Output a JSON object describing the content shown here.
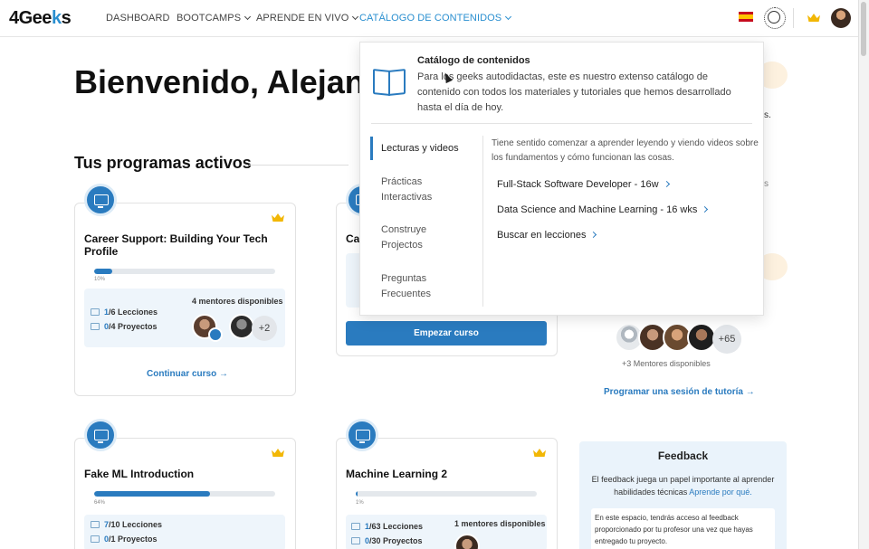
{
  "nav": {
    "logo": "4Geeks",
    "links": [
      {
        "label": "DASHBOARD"
      },
      {
        "label": "BOOTCAMPS"
      },
      {
        "label": "APRENDE EN VIVO"
      },
      {
        "label": "CATÁLOGO DE CONTENIDOS"
      }
    ]
  },
  "page": {
    "welcome": "Bienvenido, Alejand",
    "active_programs_title": "Tus programas activos"
  },
  "courses": [
    {
      "title": "Career Support: Building Your Tech Profile",
      "progress_percent": 10,
      "progress_label": "10%",
      "lessons": "1/6 Lecciones",
      "lessons_num": "1",
      "lessons_rest": "/6 Lecciones",
      "projects_num": "0",
      "projects_rest": "/4 Proyectos",
      "mentors": "4 mentores disponibles",
      "more_mentors": "+2",
      "action": "Continuar curso →"
    },
    {
      "title": "Ca",
      "action": "Empezar curso"
    },
    {
      "title": "Fake ML Introduction",
      "progress_percent": 64,
      "progress_label": "64%",
      "lessons_num": "7",
      "lessons_rest": "/10 Lecciones",
      "projects_num": "0",
      "projects_rest": "/1 Proyectos"
    },
    {
      "title": "Machine Learning 2",
      "progress_percent": 1,
      "progress_label": "1%",
      "lessons_num": "1",
      "lessons_rest": "/63 Lecciones",
      "projects_num": "0",
      "projects_rest": "/30 Proyectos",
      "mentors": "1 mentores disponibles"
    }
  ],
  "dropdown": {
    "title": "Catálogo de contenidos",
    "description": "Para los geeks autodidactas, este es nuestro extenso catálogo de contenido con todos los materiales y tutoriales que hemos desarrollado hasta el día de hoy.",
    "sidebar": [
      {
        "label": "Lecturas y videos"
      },
      {
        "label": "Prácticas Interactivas"
      },
      {
        "label": "Construye Projectos"
      },
      {
        "label": "Preguntas Frecuentes"
      }
    ],
    "intro": "Tiene sentido comenzar a aprender leyendo y viendo videos sobre los fundamentos y cómo funcionan las cosas.",
    "links": [
      {
        "label": "Full-Stack Software Developer - 16w"
      },
      {
        "label": "Data Science and Machine Learning - 16 wks"
      },
      {
        "label": "Buscar en lecciones"
      }
    ]
  },
  "right": {
    "peek_1": "s.",
    "peek_2": "s",
    "more_mentors": "+65",
    "mentors_available": "+3 Mentores disponibles",
    "schedule": "Programar una sesión de tutoría →",
    "feedback_title": "Feedback",
    "feedback_text": "El feedback juega un papel importante al aprender habilidades técnicas",
    "feedback_link": "Aprende por qué.",
    "feedback_inner": "En este espacio, tendrás acceso al feedback proporcionado por tu profesor una vez que hayas entregado tu proyecto."
  },
  "colors": {
    "accent": "#2a7bbf",
    "nav_active": "#2a8fd0",
    "crown": "#f2b705"
  }
}
